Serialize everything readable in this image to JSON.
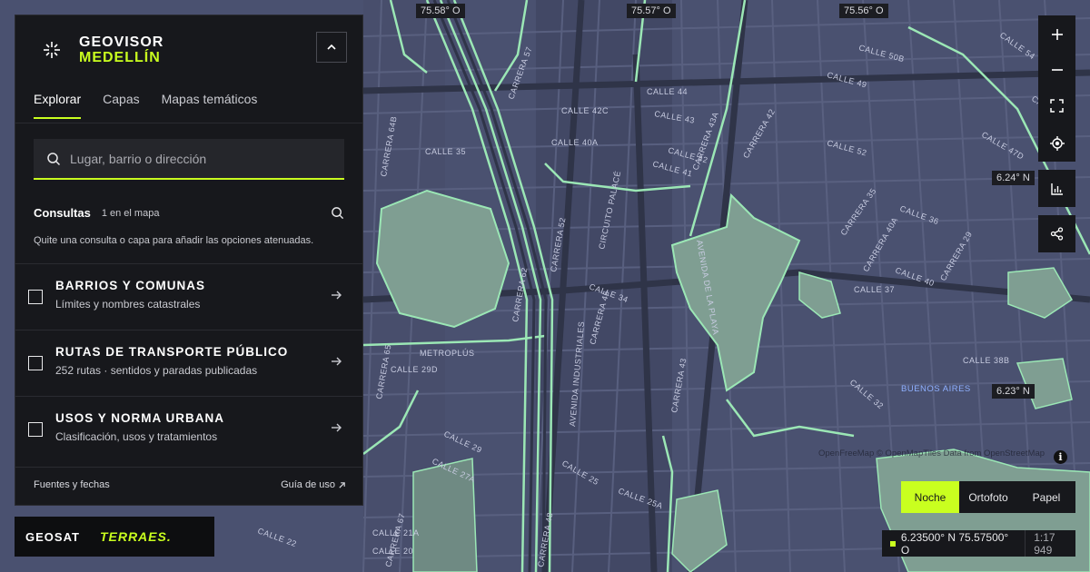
{
  "app": {
    "brand_line1": "GEOVISOR",
    "brand_line2": "MEDELLÍN"
  },
  "tabs": [
    {
      "label": "Explorar",
      "active": true
    },
    {
      "label": "Capas",
      "active": false
    },
    {
      "label": "Mapas temáticos",
      "active": false
    }
  ],
  "search": {
    "placeholder": "Lugar, barrio o dirección",
    "value": ""
  },
  "consultas": {
    "title": "Consultas",
    "count": "1 en el mapa",
    "hint": "Quite una consulta o capa para añadir las opciones atenuadas."
  },
  "layers": [
    {
      "title": "BARRIOS Y COMUNAS",
      "subtitle": "Límites y nombres catastrales",
      "checked": false
    },
    {
      "title": "RUTAS DE TRANSPORTE PÚBLICO",
      "subtitle": "252 rutas · sentidos y paradas publicadas",
      "checked": false
    },
    {
      "title": "USOS Y NORMA URBANA",
      "subtitle": "Clasificación, usos y tratamientos",
      "checked": false
    }
  ],
  "footer": {
    "sources": "Fuentes y fechas",
    "guide": "Guía de uso"
  },
  "logos": {
    "geosat": "GEOSAT",
    "terraes": "TERRAES."
  },
  "grid_labels": {
    "lon1": "75.58° O",
    "lon2": "75.57° O",
    "lon3": "75.56° O",
    "lat1": "6.24° N",
    "lat2": "6.23° N"
  },
  "street_labels": [
    "CALLE 42C",
    "CALLE 44",
    "CALLE 43",
    "CALLE 42",
    "CALLE 41",
    "CALLE 40A",
    "CALLE 34",
    "CALLE 29D",
    "CALLE 29",
    "CALLE 27A",
    "CALLE 25",
    "CALLE 25A",
    "CALLE 22",
    "CALLE 21A",
    "CALLE 20",
    "CALLE 37",
    "CALLE 40",
    "CALLE 38B",
    "CALLE 35",
    "CALLE 36",
    "CALLE 32",
    "CALLE 49",
    "CALLE 50B",
    "CALLE 54",
    "CALLE 56",
    "CALLE 52",
    "CALLE 47D",
    "CARRERA 52",
    "CARRERA 48",
    "CARRERA 46",
    "CARRERA 43",
    "CARRERA 43A",
    "CARRERA 42",
    "CARRERA 35",
    "CARRERA 40A",
    "CARRERA 29",
    "CARRERA 65",
    "CARRERA 62",
    "CARRERA 57",
    "CARRERA 64B",
    "CARRERA 67",
    "CIRCUITO PALACÉ",
    "METROPLÚS",
    "AVENIDA DE LA PLAYA",
    "AVENIDA INDUSTRIALES",
    "BUENOS AIRES"
  ],
  "attribution": "OpenFreeMap © OpenMapTiles Data from OpenStreetMap",
  "map_controls": [
    {
      "name": "zoom-in",
      "icon": "plus"
    },
    {
      "name": "zoom-out",
      "icon": "minus"
    },
    {
      "name": "fullscreen",
      "icon": "expand"
    },
    {
      "name": "locate",
      "icon": "crosshair"
    },
    {
      "name": "stats",
      "icon": "bar-chart"
    },
    {
      "name": "share",
      "icon": "share"
    }
  ],
  "basemaps": [
    {
      "label": "Noche",
      "active": true
    },
    {
      "label": "Ortofoto",
      "active": false
    },
    {
      "label": "Papel",
      "active": false
    }
  ],
  "coordinates": {
    "value": "6.23500° N 75.57500° O",
    "scale": "1:17 949"
  },
  "colors": {
    "accent": "#c9ff1f",
    "panel": "#17181c",
    "map_bg": "#4a5170",
    "green_area": "#7f9e92",
    "road_outline": "#9be7b5"
  }
}
